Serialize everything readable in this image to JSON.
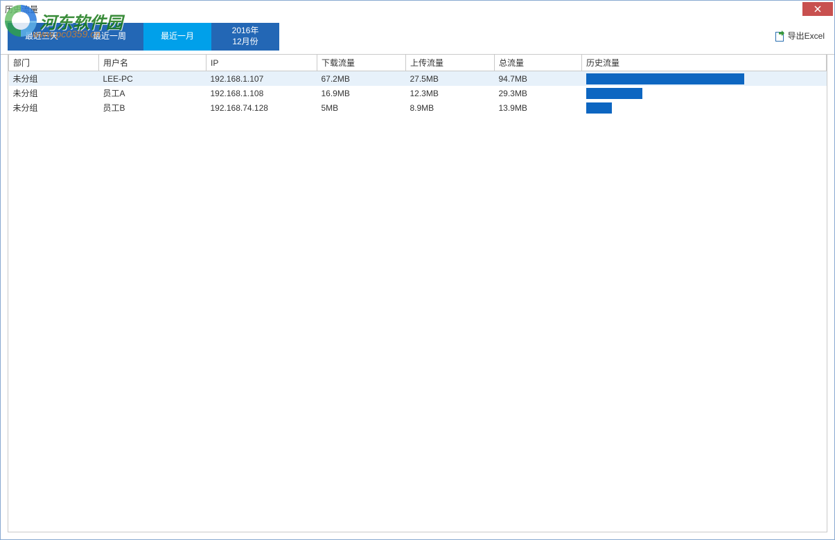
{
  "window": {
    "title": "历史流量"
  },
  "watermark": {
    "text": "河东软件园",
    "sub": "www.pc0359.cn"
  },
  "tabs": [
    {
      "label": "最近三天",
      "style": "dark"
    },
    {
      "label": "最近一周",
      "style": "dark"
    },
    {
      "label": "最近一月",
      "style": "active"
    },
    {
      "label": "2016年\n12月份",
      "style": "last"
    }
  ],
  "export_label": "导出Excel",
  "columns": {
    "dept": "部门",
    "user": "用户名",
    "ip": "IP",
    "download": "下载流量",
    "upload": "上传流量",
    "total": "总流量",
    "history": "历史流量"
  },
  "rows": [
    {
      "dept": "未分组",
      "user": "LEE-PC",
      "ip": "192.168.1.107",
      "download": "67.2MB",
      "upload": "27.5MB",
      "total": "94.7MB",
      "bar_pct": 67
    },
    {
      "dept": "未分组",
      "user": "员工A",
      "ip": "192.168.1.108",
      "download": "16.9MB",
      "upload": "12.3MB",
      "total": "29.3MB",
      "bar_pct": 24
    },
    {
      "dept": "未分组",
      "user": "员工B",
      "ip": "192.168.74.128",
      "download": "5MB",
      "upload": "8.9MB",
      "total": "13.9MB",
      "bar_pct": 11
    }
  ],
  "chart_data": {
    "type": "bar",
    "title": "历史流量",
    "categories": [
      "LEE-PC",
      "员工A",
      "员工B"
    ],
    "values": [
      94.7,
      29.3,
      13.9
    ],
    "xlabel": "",
    "ylabel": "MB",
    "ylim": [
      0,
      100
    ]
  },
  "colors": {
    "accent": "#0d66c1",
    "tab_dark": "#2367b5",
    "tab_active": "#00a0ea",
    "close": "#c8504f"
  }
}
